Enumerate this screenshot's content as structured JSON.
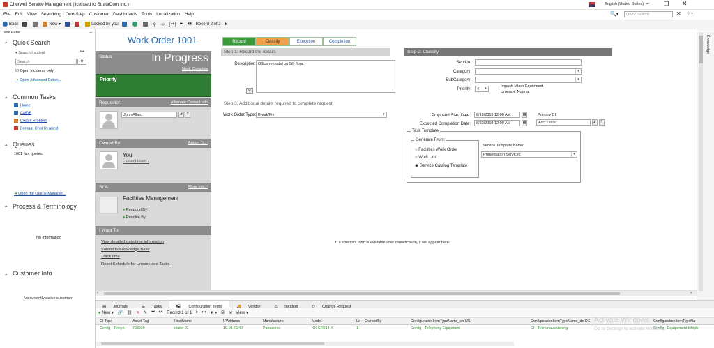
{
  "window": {
    "title": "Cherwell Service Management (licensed to StrataCom Inc.)",
    "language": "English (United States)",
    "quick_search_placeholder": "Quick Search"
  },
  "menu": [
    "File",
    "Edit",
    "View",
    "Searching",
    "One-Step",
    "Customer",
    "Dashboards",
    "Tools",
    "Localization",
    "Help"
  ],
  "toolbar": {
    "back": "Back",
    "new": "New",
    "locked": "Locked by you",
    "record_nav": "Record 2 of 2"
  },
  "taskpane": {
    "title": "Task Pane",
    "quick_search": "Quick Search",
    "search_incident": "Search Incident",
    "search_value": "Search",
    "open_incidents_only": "Open incidents only",
    "open_advanced": "Open Advanced Editor...",
    "common_tasks": "Common Tasks",
    "tasks": [
      "Home",
      "CMDB",
      "Create Problem",
      "Bomgar Chat Request"
    ],
    "queues": "Queues",
    "not_queued": "1001 Not queued",
    "open_queue_manager": "Open the Queue Manager...",
    "process": "Process & Terminology",
    "no_info": "No information",
    "customer_info": "Customer Info",
    "no_customer": "No currently active customer"
  },
  "record": {
    "title": "Work Order 1001",
    "status_label": "Status",
    "status": "In Progress",
    "next": "Next: Complete",
    "priority": "Priority",
    "requestor_label": "Requestor:",
    "alt_contact": "Alternate Contact Info",
    "requestor": "John Allard",
    "owned_label": "Owned By:",
    "assign": "Assign To...",
    "you": "You",
    "select_team": "- select team -",
    "sla_label": "SLA:",
    "more_info": "More Info...",
    "sla_team": "Facilities Management",
    "respond": "Respond By:",
    "resolve": "Resolve By:",
    "want_label": "I Want To:",
    "actions": [
      "View detailed date/time information",
      "Submit to Knowledge Base",
      "Track time",
      "Reset Schedule for Unexecuted Tasks"
    ]
  },
  "tabs": [
    "Record",
    "Classify",
    "Execution",
    "Completion"
  ],
  "step1": {
    "title": "Step 1:  Record the details",
    "desc_label": "Description:",
    "desc": "Office remodel on 5th floor."
  },
  "step2": {
    "title": "Step 2:  Classify",
    "service": "Service:",
    "category": "Category:",
    "subcategory": "SubCategory:",
    "priority": "Priority:",
    "priority_val": "4",
    "impact": "Impact: Minor Equipment",
    "urgency": "Urgency: Normal"
  },
  "step3": {
    "title": "Step 3:  Additional details required to complete request",
    "wo_type_label": "Work Order Type:",
    "wo_type": "Break/Fix",
    "proposed_start": "Proposed Start Date:",
    "proposed_start_val": "6/19/2019 12:00 AM",
    "expected": "Expected Completion Date:",
    "expected_val": "6/22/2019 12:00 AM",
    "primary_ci": "Primary CI:",
    "primary_ci_val": "Acct Dialer"
  },
  "template": {
    "title": "Task Template",
    "generate": "Generate From:",
    "options": [
      "Facilities Work Order",
      "Work Unit",
      "Service Catalog Template"
    ],
    "stn_label": "Service Template Name:",
    "stn": "Presentation Services"
  },
  "specifics": "If a specifics form is available after classification, it will appear here.",
  "bottom_tabs": [
    "Journals",
    "Tasks",
    "Configuration Items",
    "Vendor",
    "Incident",
    "Change Request"
  ],
  "grid": {
    "new": "New",
    "view": "View",
    "record": "Record 1 of 1",
    "headers": [
      "CI Type",
      "Asset Tag",
      "HostName",
      "IPAddress",
      "Manufacturer",
      "Model",
      "Lo",
      "Owned By",
      "ConfigurationItemTypeName_en-US",
      "ConfigurationItemTypeName_de-DE",
      "ConfigurationItemTypeNa"
    ],
    "row": [
      "Config - Teleph",
      "723939",
      "dialer-01",
      "10.10.2.240",
      "Panasonic",
      "KX-GR214-X",
      "1",
      "",
      "Config - Telephony Equipment",
      "CI - Telefonausrüstung",
      "Config - Equipement téléph"
    ]
  },
  "knowledge": "Knowledge",
  "watermark": "Activate Windows",
  "watermark2": "Go to Settings to activate Windows."
}
